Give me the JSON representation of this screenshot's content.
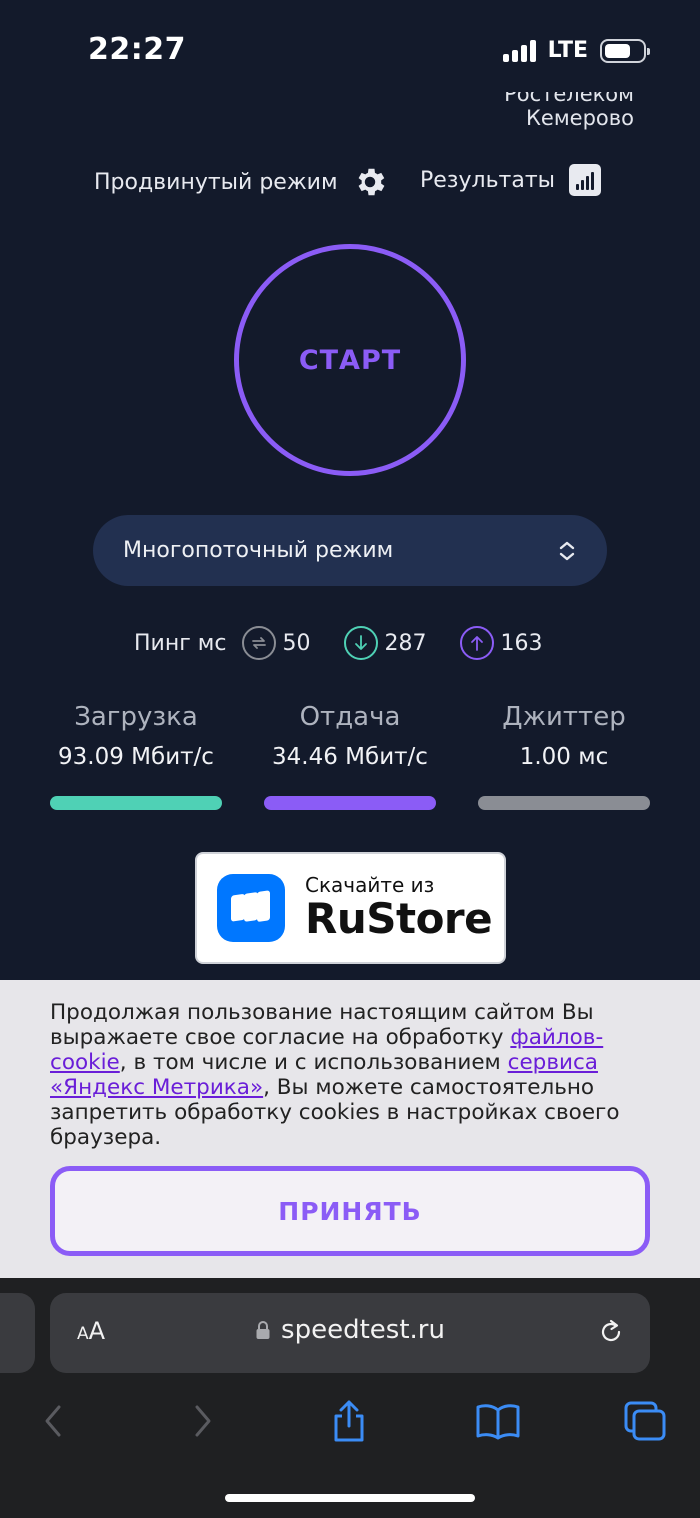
{
  "status": {
    "time": "22:27",
    "network": "LTE"
  },
  "provider": {
    "name": "Ростелеком",
    "city": "Кемерово"
  },
  "nav": {
    "advanced_label": "Продвинутый режим",
    "results_label": "Результаты"
  },
  "start": {
    "label": "СТАРТ"
  },
  "mode": {
    "selected": "Многопоточный режим"
  },
  "ping": {
    "title": "Пинг мс",
    "idle": "50",
    "download": "287",
    "upload": "163"
  },
  "metrics": {
    "download": {
      "title": "Загрузка",
      "value": "93.09 Мбит/с",
      "color": "#4fd1b5"
    },
    "upload": {
      "title": "Отдача",
      "value": "34.46 Мбит/с",
      "color": "#8b5cf6"
    },
    "jitter": {
      "title": "Джиттер",
      "value": "1.00 мс",
      "color": "#8a8d94"
    }
  },
  "rustore": {
    "small": "Скачайте из",
    "big": "RuStore"
  },
  "cookie": {
    "text_1": "Продолжая пользование настоящим сайтом Вы выражаете свое согласие на обработку ",
    "link_1": "файлов-cookie",
    "text_2": ", в том числе и с использованием ",
    "link_2": "сервиса «Яндекс Метрика»",
    "text_3": ", Вы можете самостоятельно запретить обработку cookies в настройках своего браузера.",
    "accept_label": "ПРИНЯТЬ"
  },
  "browser": {
    "aa_label_small": "A",
    "aa_label_big": "A",
    "url": "speedtest.ru"
  },
  "colors": {
    "accent": "#8b5cf6",
    "background": "#131a2b",
    "browser_blue": "#3b8cf5"
  }
}
